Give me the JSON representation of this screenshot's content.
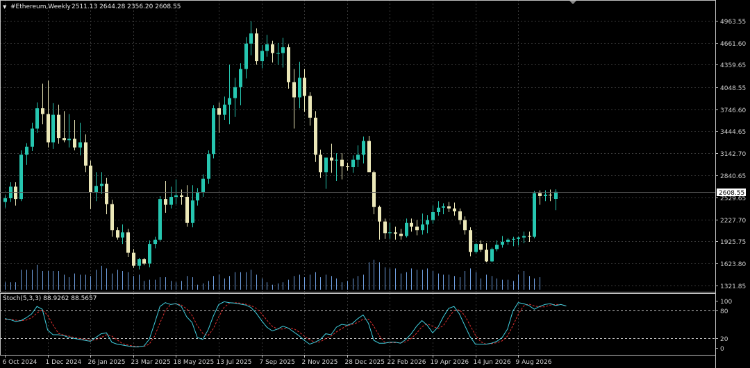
{
  "header": {
    "arrow": "▼",
    "symbol": "#Ethereum,Weekly",
    "ohlc": "2511.13 2644.28 2356.20 2608.55"
  },
  "stoch": {
    "title": "Stoch(5,3,3) 88.9262 88.5657",
    "levels": [
      "100",
      "80",
      "20",
      "0"
    ],
    "level_values": [
      100,
      80,
      20,
      0
    ]
  },
  "last_price_label": "2608.55",
  "colors": {
    "background": "#000000",
    "grid": "#3a3a3a",
    "frame": "#c0c0c0",
    "bull": "#26c6b0",
    "bear": "#ece8b8",
    "volume": "#6f9fe0",
    "stoch_main": "#40d0e0",
    "stoch_signal": "#e03030",
    "price_tag_bg": "#ffffff",
    "price_tag_fg": "#000000"
  },
  "chart_data": {
    "type": "candlestick",
    "symbol": "#Ethereum",
    "timeframe": "Weekly",
    "ylim": [
      1280,
      5060
    ],
    "y_ticks": [
      "4963.55",
      "4661.60",
      "4359.65",
      "4048.55",
      "3746.60",
      "3444.65",
      "3142.70",
      "2840.65",
      "2529.65",
      "2227.70",
      "1925.75",
      "1623.80",
      "1321.85"
    ],
    "y_tick_values": [
      4963.55,
      4661.6,
      4359.65,
      4048.55,
      3746.6,
      3444.65,
      3142.7,
      2840.65,
      2529.65,
      2227.7,
      1925.75,
      1623.8,
      1321.85
    ],
    "x_ticks": [
      "6 Oct 2024",
      "1 Dec 2024",
      "26 Jan 2025",
      "23 Mar 2025",
      "18 May 2025",
      "13 Jul 2025",
      "7 Sep 2025",
      "2 Nov 2025",
      "28 Dec 2025",
      "22 Feb 2026",
      "19 Apr 2026",
      "14 Jun 2026",
      "9 Aug 2026"
    ],
    "x_tick_bars": [
      0,
      8,
      16,
      24,
      32,
      40,
      48,
      56,
      64,
      72,
      80,
      88,
      96
    ],
    "candles": [
      [
        2470,
        2560,
        2390,
        2520
      ],
      [
        2520,
        2740,
        2470,
        2680
      ],
      [
        2680,
        2740,
        2420,
        2510
      ],
      [
        2510,
        3180,
        2480,
        3120
      ],
      [
        3120,
        3280,
        2980,
        3230
      ],
      [
        3230,
        3560,
        3170,
        3480
      ],
      [
        3480,
        3840,
        3420,
        3760
      ],
      [
        3760,
        4100,
        3540,
        3680
      ],
      [
        3680,
        4140,
        3220,
        3290
      ],
      [
        3290,
        3830,
        3200,
        3670
      ],
      [
        3670,
        3810,
        3270,
        3350
      ],
      [
        3350,
        3720,
        3290,
        3320
      ],
      [
        3320,
        3680,
        3220,
        3340
      ],
      [
        3340,
        3600,
        3180,
        3220
      ],
      [
        3220,
        3560,
        3110,
        3290
      ],
      [
        3290,
        3400,
        2880,
        2970
      ],
      [
        2970,
        3040,
        2370,
        2600
      ],
      [
        2600,
        2880,
        2480,
        2690
      ],
      [
        2690,
        2880,
        2580,
        2720
      ],
      [
        2720,
        2800,
        2300,
        2440
      ],
      [
        2440,
        2500,
        1990,
        2080
      ],
      [
        2080,
        2120,
        1950,
        1980
      ],
      [
        1980,
        2160,
        1890,
        2050
      ],
      [
        2050,
        2100,
        1710,
        1770
      ],
      [
        1770,
        1820,
        1560,
        1590
      ],
      [
        1590,
        1700,
        1540,
        1680
      ],
      [
        1680,
        1700,
        1600,
        1620
      ],
      [
        1620,
        1940,
        1570,
        1890
      ],
      [
        1890,
        1990,
        1830,
        1950
      ],
      [
        1950,
        2550,
        1930,
        2510
      ],
      [
        2510,
        2760,
        2320,
        2430
      ],
      [
        2430,
        2680,
        2380,
        2540
      ],
      [
        2540,
        2780,
        2440,
        2560
      ],
      [
        2560,
        2640,
        2430,
        2540
      ],
      [
        2540,
        2700,
        2130,
        2180
      ],
      [
        2180,
        2700,
        2120,
        2490
      ],
      [
        2490,
        2660,
        2420,
        2600
      ],
      [
        2600,
        2850,
        2540,
        2790
      ],
      [
        2790,
        3180,
        2720,
        3130
      ],
      [
        3130,
        3800,
        3070,
        3760
      ],
      [
        3760,
        3840,
        3420,
        3670
      ],
      [
        3670,
        3920,
        3600,
        3810
      ],
      [
        3810,
        4360,
        3540,
        3900
      ],
      [
        3900,
        4180,
        3640,
        4050
      ],
      [
        4050,
        4380,
        3800,
        4300
      ],
      [
        4300,
        4740,
        4170,
        4650
      ],
      [
        4650,
        4960,
        4490,
        4790
      ],
      [
        4790,
        4860,
        4360,
        4410
      ],
      [
        4410,
        4630,
        4310,
        4550
      ],
      [
        4550,
        4770,
        4470,
        4640
      ],
      [
        4640,
        4690,
        4390,
        4520
      ],
      [
        4520,
        4660,
        4360,
        4520
      ],
      [
        4520,
        4730,
        4320,
        4600
      ],
      [
        4600,
        4640,
        4030,
        4120
      ],
      [
        4120,
        4300,
        3480,
        3910
      ],
      [
        3910,
        4400,
        3760,
        4180
      ],
      [
        4180,
        4300,
        3710,
        3930
      ],
      [
        3930,
        3980,
        3520,
        3630
      ],
      [
        3630,
        3720,
        3020,
        3120
      ],
      [
        3120,
        3190,
        2800,
        2880
      ],
      [
        2880,
        3070,
        2650,
        3080
      ],
      [
        3080,
        3270,
        2870,
        3040
      ],
      [
        3040,
        3140,
        2760,
        3050
      ],
      [
        3050,
        3140,
        2780,
        2960
      ],
      [
        2960,
        3010,
        2900,
        2950
      ],
      [
        2950,
        3110,
        2870,
        3050
      ],
      [
        3050,
        3250,
        2950,
        3120
      ],
      [
        3120,
        3370,
        3000,
        3310
      ],
      [
        3310,
        3380,
        2940,
        2880
      ],
      [
        2880,
        2900,
        2300,
        2400
      ],
      [
        2400,
        2420,
        1950,
        2200
      ],
      [
        2200,
        2240,
        1960,
        2040
      ],
      [
        2040,
        2180,
        1960,
        2050
      ],
      [
        2050,
        2130,
        1950,
        2030
      ],
      [
        2030,
        2100,
        1950,
        2000
      ],
      [
        2000,
        2240,
        1980,
        2180
      ],
      [
        2180,
        2240,
        2060,
        2130
      ],
      [
        2130,
        2220,
        2010,
        2080
      ],
      [
        2080,
        2310,
        2020,
        2160
      ],
      [
        2160,
        2290,
        2040,
        2220
      ],
      [
        2220,
        2420,
        2170,
        2330
      ],
      [
        2330,
        2480,
        2280,
        2390
      ],
      [
        2390,
        2450,
        2300,
        2410
      ],
      [
        2410,
        2470,
        2330,
        2380
      ],
      [
        2380,
        2460,
        2280,
        2340
      ],
      [
        2340,
        2380,
        2160,
        2220
      ],
      [
        2220,
        2270,
        2020,
        2080
      ],
      [
        2080,
        2120,
        1720,
        1780
      ],
      [
        1780,
        1900,
        1760,
        1890
      ],
      [
        1890,
        1940,
        1780,
        1810
      ],
      [
        1810,
        1900,
        1640,
        1650
      ],
      [
        1650,
        1840,
        1640,
        1820
      ],
      [
        1820,
        1940,
        1790,
        1880
      ],
      [
        1880,
        2000,
        1840,
        1920
      ],
      [
        1920,
        1970,
        1880,
        1950
      ],
      [
        1950,
        1990,
        1860,
        1960
      ],
      [
        1960,
        1990,
        1870,
        1980
      ],
      [
        1980,
        2060,
        1900,
        2000
      ],
      [
        2000,
        2060,
        1920,
        1990
      ],
      [
        1990,
        2620,
        1970,
        2590
      ],
      [
        2590,
        2630,
        2430,
        2550
      ],
      [
        2550,
        2630,
        2480,
        2570
      ],
      [
        2570,
        2640,
        2480,
        2560
      ],
      [
        2511.13,
        2644.28,
        2356.2,
        2608.55
      ]
    ],
    "volume": [
      0.3,
      0.3,
      0.3,
      0.8,
      0.8,
      0.8,
      1.0,
      0.75,
      0.75,
      0.75,
      0.75,
      0.6,
      0.5,
      0.65,
      0.6,
      0.6,
      0.55,
      0.8,
      0.95,
      0.85,
      0.65,
      0.8,
      0.75,
      0.7,
      0.55,
      0.6,
      0.35,
      0.4,
      0.4,
      0.5,
      0.5,
      0.35,
      0.3,
      0.35,
      0.55,
      0.5,
      0.2,
      0.25,
      0.35,
      0.55,
      0.6,
      0.45,
      0.55,
      0.7,
      0.7,
      0.7,
      0.8,
      0.6,
      0.45,
      0.3,
      0.2,
      0.25,
      0.3,
      0.4,
      0.55,
      0.6,
      0.5,
      0.6,
      0.7,
      0.5,
      0.6,
      0.55,
      0.45,
      0.3,
      0.35,
      0.45,
      0.55,
      0.6,
      1.1,
      1.2,
      1.1,
      0.9,
      0.85,
      0.85,
      0.65,
      0.7,
      0.85,
      0.8,
      0.8,
      0.85,
      0.75,
      0.65,
      0.6,
      0.6,
      0.55,
      0.5,
      0.75,
      0.85,
      0.7,
      0.45,
      0.6,
      0.55,
      0.45,
      0.4,
      0.4,
      0.35,
      0.6,
      0.75,
      0.55,
      0.45,
      0.5
    ],
    "stoch_main": [
      62,
      60,
      56,
      58,
      64,
      72,
      88,
      82,
      38,
      28,
      28,
      26,
      22,
      20,
      18,
      16,
      14,
      22,
      30,
      32,
      12,
      8,
      6,
      4,
      2,
      2,
      4,
      18,
      52,
      88,
      96,
      92,
      94,
      88,
      66,
      54,
      22,
      18,
      38,
      68,
      92,
      98,
      96,
      95,
      93,
      91,
      86,
      74,
      58,
      44,
      36,
      40,
      46,
      42,
      34,
      26,
      16,
      8,
      12,
      18,
      30,
      28,
      44,
      50,
      48,
      52,
      62,
      70,
      52,
      16,
      10,
      10,
      12,
      12,
      10,
      18,
      30,
      46,
      58,
      48,
      32,
      44,
      66,
      84,
      88,
      72,
      48,
      24,
      8,
      8,
      8,
      10,
      14,
      22,
      40,
      78,
      96,
      94,
      90,
      82,
      88,
      92,
      94,
      90,
      92,
      88.93
    ],
    "stoch_signal": [
      60,
      61,
      59,
      58,
      59,
      64,
      74,
      81,
      69,
      49,
      31,
      27,
      25,
      22,
      20,
      18,
      16,
      17,
      22,
      28,
      25,
      17,
      9,
      6,
      4,
      3,
      3,
      8,
      25,
      53,
      79,
      92,
      94,
      91,
      83,
      69,
      47,
      31,
      26,
      41,
      66,
      86,
      95,
      96,
      95,
      93,
      90,
      84,
      73,
      59,
      46,
      40,
      40,
      42,
      41,
      34,
      25,
      17,
      12,
      13,
      20,
      25,
      34,
      41,
      47,
      50,
      54,
      61,
      61,
      46,
      26,
      12,
      11,
      11,
      11,
      13,
      20,
      31,
      45,
      51,
      46,
      41,
      47,
      65,
      79,
      81,
      69,
      48,
      27,
      13,
      8,
      9,
      11,
      15,
      25,
      47,
      71,
      89,
      93,
      89,
      87,
      87,
      91,
      92,
      92,
      88.57
    ]
  }
}
